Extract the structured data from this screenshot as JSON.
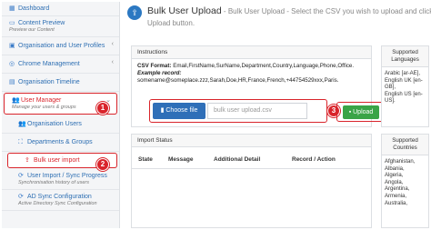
{
  "sidebar": {
    "dashboard": "Dashboard",
    "content_preview": "Content Preview",
    "content_preview_sub": "Preview our Content",
    "org_user_profiles": "Organisation and User Profiles",
    "chrome_management": "Chrome Management",
    "org_timeline": "Organisation Timeline",
    "user_manager": "User Manager",
    "user_manager_sub": "Manage your users & groups",
    "organisation_users": "Organisation Users",
    "departments_groups": "Departments & Groups",
    "bulk_user_import": "Bulk user import",
    "user_import_sync": "User Import / Sync Progress",
    "user_import_sync_sub": "Synchronisation history of users",
    "ad_sync": "AD Sync Configuration",
    "ad_sync_sub": "Active Directory Sync Configuration"
  },
  "header": {
    "title": "Bulk User Upload",
    "subtitle_line1": " - Bulk User Upload - Select the CSV you wish to upload and click the",
    "subtitle_line2": "Upload button."
  },
  "instructions": {
    "heading": "Instructions",
    "csv_format_label": "CSV Format:",
    "csv_format": " Email,FirstName,SurName,Department,Country,Language,Phone,Office.",
    "example_label": "Example record:",
    "example": "somename@someplace.zzz,Sarah,Doe,HR,France,French,+44754529xxx,Paris."
  },
  "upload": {
    "choose_label": "Choose file",
    "file_value": "bulk user upload.csv",
    "upload_label": "Upload"
  },
  "import_status": {
    "heading": "Import Status",
    "columns": [
      "State",
      "Message",
      "Additional Detail",
      "Record / Action"
    ]
  },
  "languages": {
    "heading": "Supported Languages",
    "items": [
      "Arabic [ar-AE],",
      "English UK [en-GB],",
      "English US [en-US]."
    ]
  },
  "countries": {
    "heading": "Supported Countries",
    "items": [
      "Afghanistan,",
      "Albania,",
      "Algeria,",
      "Angola,",
      "Argentina,",
      "Armenia,",
      "Australia,"
    ]
  },
  "badges": [
    "1",
    "2",
    "3",
    "4"
  ],
  "colors": {
    "accent": "#2f6fb8",
    "highlight": "#d9242b",
    "upload_green": "#3aa447"
  }
}
